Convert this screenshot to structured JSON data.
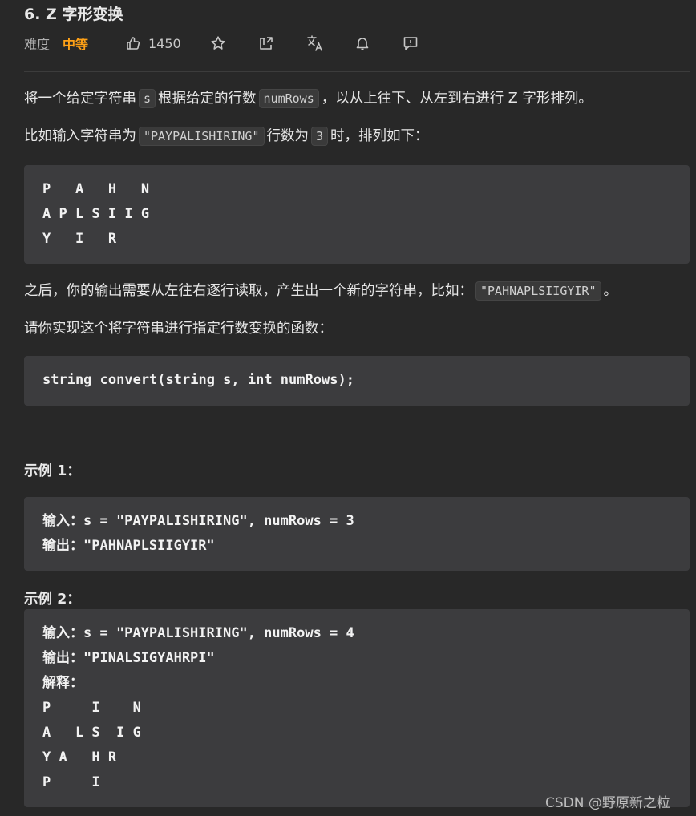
{
  "problem": {
    "title": "6. Z 字形变换"
  },
  "meta": {
    "difficulty_label": "难度",
    "difficulty_value": "中等",
    "likes": "1450"
  },
  "description": {
    "p1_a": "将一个给定字符串",
    "p1_code1": "s",
    "p1_b": "根据给定的行数",
    "p1_code2": "numRows",
    "p1_c": "，以从上往下、从左到右进行 Z 字形排列。",
    "p2_a": "比如输入字符串为",
    "p2_code1": "\"PAYPALISHIRING\"",
    "p2_b": "行数为",
    "p2_code2": "3",
    "p2_c": "时，排列如下：",
    "zigzag_lines": [
      "P   A   H   N",
      "A P L S I I G",
      "Y   I   R"
    ],
    "p3_a": "之后，你的输出需要从左往右逐行读取，产生出一个新的字符串，比如：",
    "p3_code": "\"PAHNAPLSIIGYIR\"",
    "p3_b": "。",
    "p4": "请你实现这个将字符串进行指定行数变换的函数：",
    "signature": "string convert(string s, int numRows);"
  },
  "examples": [
    {
      "heading": "示例 1：",
      "lines": [
        "输入：s = \"PAYPALISHIRING\", numRows = 3",
        "输出：\"PAHNAPLSIIGYIR\""
      ]
    },
    {
      "heading": "示例 2：",
      "lines": [
        "输入：s = \"PAYPALISHIRING\", numRows = 4",
        "输出：\"PINALSIGYAHRPI\"",
        "解释：",
        "P     I    N",
        "A   L S  I G",
        "Y A   H R",
        "P     I"
      ]
    }
  ],
  "watermark": "CSDN @野原新之粒",
  "icons": [
    "thumbs-up-icon",
    "star-icon",
    "share-icon",
    "translate-icon",
    "bell-icon",
    "feedback-icon"
  ],
  "colors": {
    "background": "#282828",
    "code_bg": "#3c3c3e",
    "difficulty": "#ffa116"
  }
}
